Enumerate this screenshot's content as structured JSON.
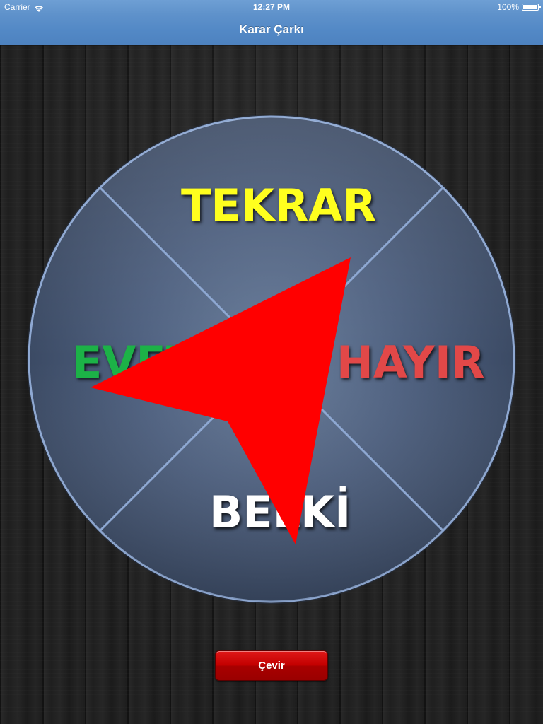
{
  "status_bar": {
    "carrier": "Carrier",
    "time": "12:27 PM",
    "battery": "100%",
    "icons": [
      "wifi-icon",
      "battery-icon"
    ]
  },
  "nav_bar": {
    "title": "Karar Çarkı"
  },
  "wheel": {
    "segments": [
      {
        "position": "top",
        "label": "TEKRAR",
        "color": "#ffff1e"
      },
      {
        "position": "left",
        "label": "EVET",
        "color": "#1cb247"
      },
      {
        "position": "right",
        "label": "HAYIR",
        "color": "#e24848"
      },
      {
        "position": "bottom",
        "label": "BELKİ",
        "color": "#ffffff"
      }
    ],
    "face_color": "#4b5c78",
    "rim_color": "#8ea8d2"
  },
  "pointer": {
    "icon": "pointer-arrow-icon",
    "color": "#ff0000"
  },
  "spin_button": {
    "label": "Çevir",
    "color": "#c30000"
  }
}
